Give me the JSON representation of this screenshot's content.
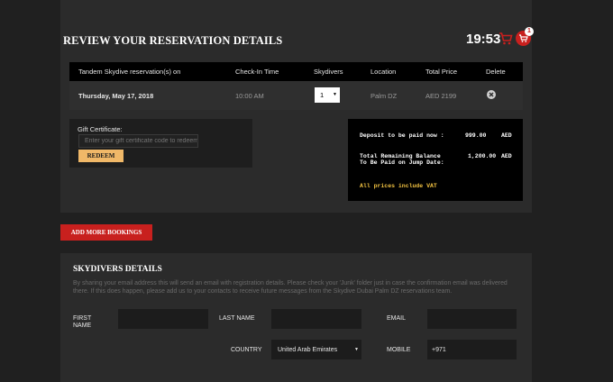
{
  "reservation": {
    "title": "REVIEW YOUR RESERVATION DETAILS",
    "timer": "19:53",
    "cart_badge": "1",
    "table": {
      "headers": [
        "Tandem Skydive reservation(s) on",
        "Check-In Time",
        "Skydivers",
        "Location",
        "Total Price",
        "Delete"
      ],
      "row": {
        "date": "Thursday, May 17, 2018",
        "time": "10:00 AM",
        "skydivers": "1",
        "location": "Palm DZ",
        "price": "AED 2199"
      }
    },
    "gift": {
      "label": "Gift Certificate:",
      "placeholder": "Enter your gift certificate code to redeem",
      "redeem_label": "REDEEM"
    },
    "summary": {
      "deposit_label": "Deposit to be paid now :",
      "deposit_amount": "999.00",
      "deposit_currency": "AED",
      "balance_label": "Total Remaining Balance To Be Paid on Jump Date:",
      "balance_amount": "1,200.00",
      "balance_currency": "AED",
      "vat_note": "All prices include VAT"
    }
  },
  "add_more_label": "ADD MORE BOOKINGS",
  "skydivers": {
    "title": "SKYDIVERS DETAILS",
    "notice": "By sharing your email address this will send an email with registration details. Please check your 'Junk' folder just in case the confirmation email was delivered there. If this does happen, please add us to your contacts to receive future messages from the Skydive Dubai Palm DZ reservations team.",
    "first_name_label": "FIRST NAME",
    "last_name_label": "LAST NAME",
    "email_label": "EMAIL",
    "country_label": "COUNTRY",
    "country_value": "United Arab Emirates",
    "mobile_label": "MOBILE",
    "mobile_value": "+971",
    "first_name_value": "",
    "last_name_value": "",
    "email_value": ""
  },
  "colors": {
    "accent_red": "#c8201e",
    "redeem_yellow": "#f0b868",
    "vat_yellow": "#f0c040"
  }
}
